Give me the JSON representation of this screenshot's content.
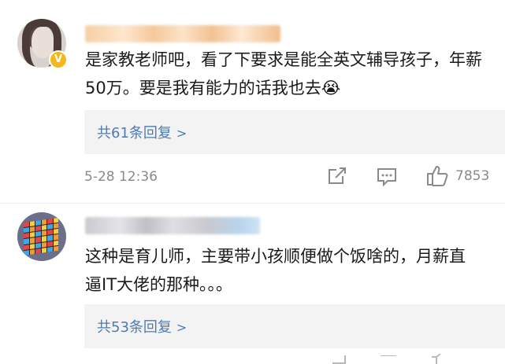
{
  "comments": [
    {
      "badge": "V",
      "text": "是家教老师吧，看了下要求是能全英文辅导孩子，年薪50万。要是我有能力的话我也去😭",
      "reply_link": "共61条回复",
      "time": "5-28 12:36",
      "likes": "7853"
    },
    {
      "text": "这种是育儿师，主要带小孩顺便做个饭啥的，月薪直逼IT大佬的那种。。。",
      "reply_link": "共53条回复"
    }
  ],
  "colors": {
    "link": "#4f7bb0",
    "meta": "#8a8a8a",
    "reply_bg": "#f3f3f3",
    "badge": "#f3b81d"
  },
  "icons": [
    "share-icon",
    "comment-icon",
    "like-icon",
    "chevron-right-icon",
    "crying-emoji-icon",
    "verified-badge-icon"
  ]
}
